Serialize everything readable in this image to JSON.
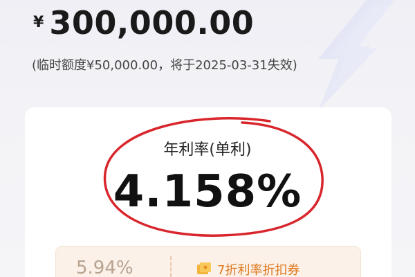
{
  "balance": {
    "currency_sign": "¥",
    "amount": "300,000.00"
  },
  "temporary_quota_note": "(临时额度¥50,000.00，将于2025-03-31失效)",
  "rate": {
    "label": "年利率(单利)",
    "value": "4.158%"
  },
  "coupon": {
    "original_rate": "5.94%",
    "text": "7折利率折扣券"
  },
  "colors": {
    "accent_orange": "#e07a1f",
    "highlight_red": "#d8262c",
    "card_bg": "#ffffff"
  },
  "icons": {
    "coupon": "coupon-ticket-icon",
    "decoration": "lightning-bolt-icon"
  }
}
